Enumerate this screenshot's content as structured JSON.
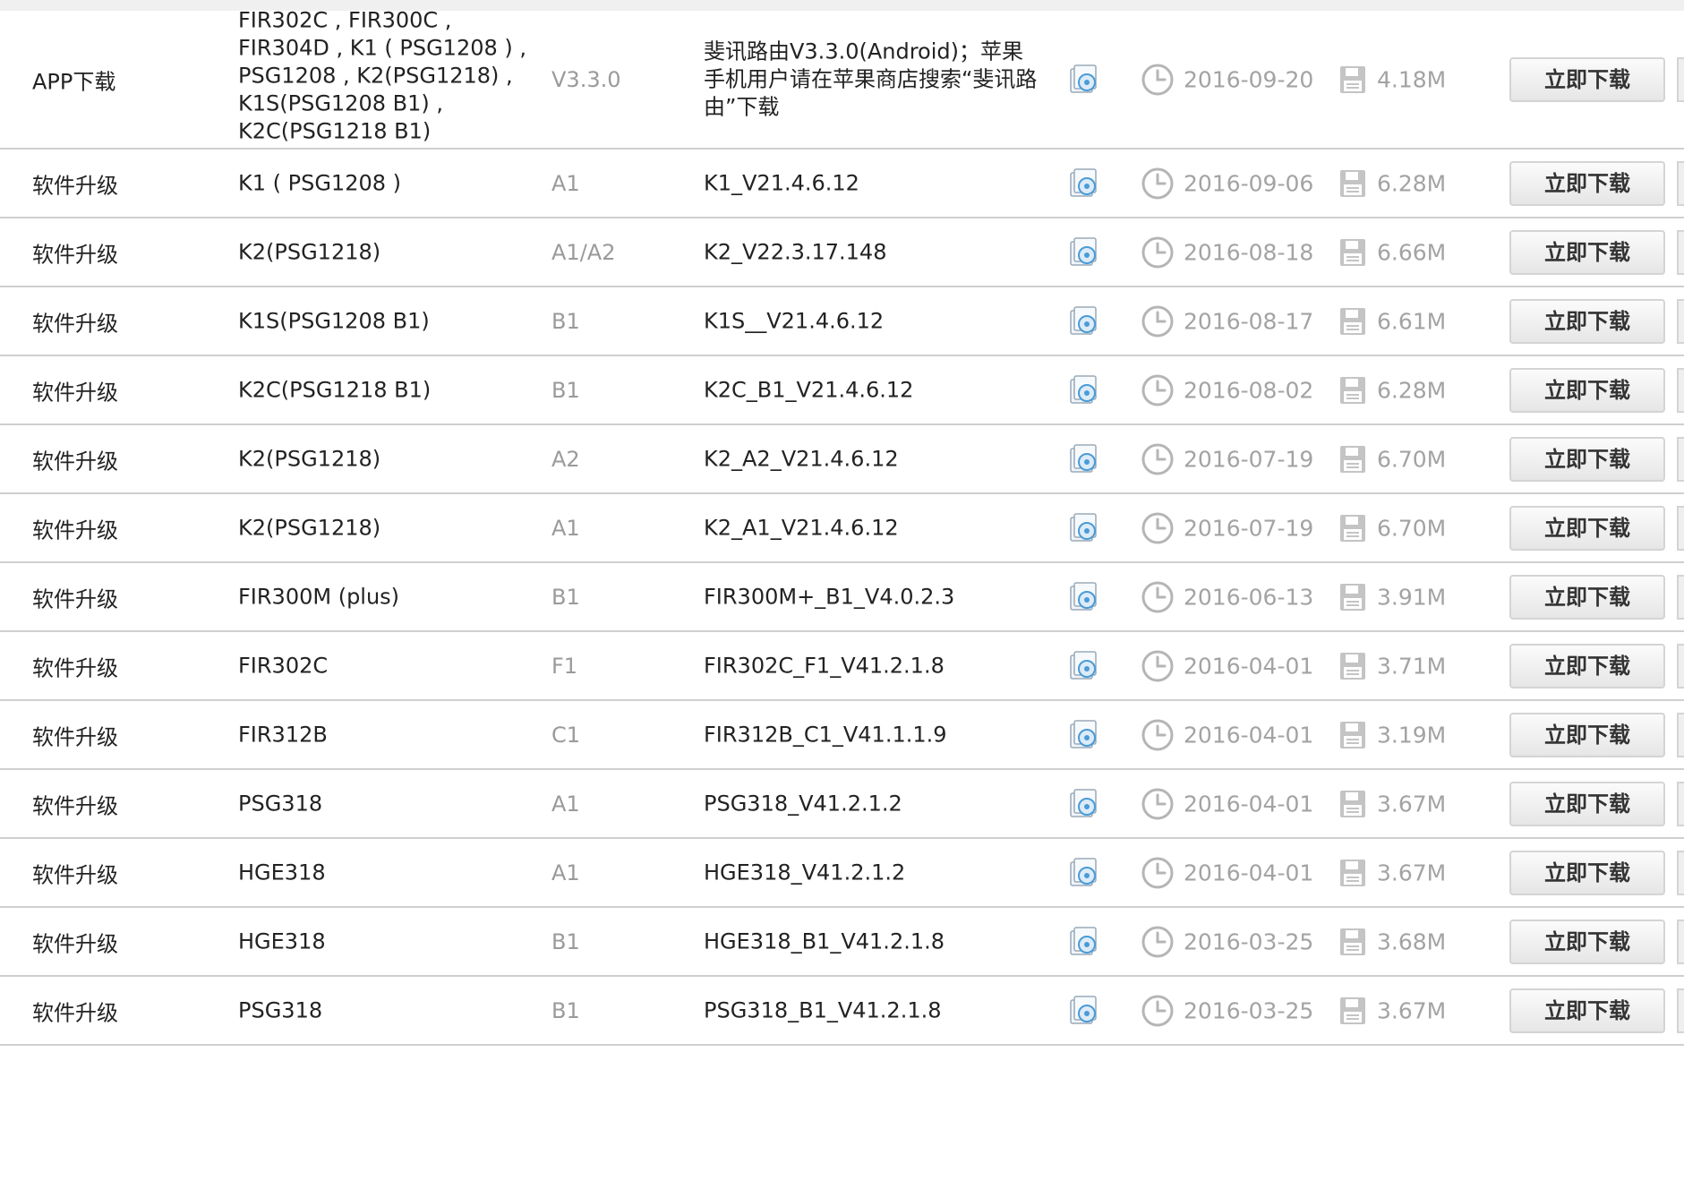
{
  "download_button_label": "立即下载",
  "rows": [
    {
      "type": "APP下载",
      "model": "FIR302C , FIR300C , FIR304D , K1 ( PSG1208 ) , PSG1208 , K2(PSG1218) , K1S(PSG1208 B1) , K2C(PSG1218 B1)",
      "hardware": "V3.3.0",
      "version": "斐讯路由V3.3.0(Android)；苹果手机用户请在苹果商店搜索“斐讯路由”下载",
      "date": "2016-09-20",
      "size": "4.18M"
    },
    {
      "type": "软件升级",
      "model": "K1 ( PSG1208 )",
      "hardware": "A1",
      "version": "K1_V21.4.6.12",
      "date": "2016-09-06",
      "size": "6.28M"
    },
    {
      "type": "软件升级",
      "model": "K2(PSG1218)",
      "hardware": "A1/A2",
      "version": "K2_V22.3.17.148",
      "date": "2016-08-18",
      "size": "6.66M"
    },
    {
      "type": "软件升级",
      "model": "K1S(PSG1208 B1)",
      "hardware": "B1",
      "version": "K1S__V21.4.6.12",
      "date": "2016-08-17",
      "size": "6.61M"
    },
    {
      "type": "软件升级",
      "model": "K2C(PSG1218 B1)",
      "hardware": "B1",
      "version": "K2C_B1_V21.4.6.12",
      "date": "2016-08-02",
      "size": "6.28M"
    },
    {
      "type": "软件升级",
      "model": "K2(PSG1218)",
      "hardware": "A2",
      "version": "K2_A2_V21.4.6.12",
      "date": "2016-07-19",
      "size": "6.70M"
    },
    {
      "type": "软件升级",
      "model": "K2(PSG1218)",
      "hardware": "A1",
      "version": "K2_A1_V21.4.6.12",
      "date": "2016-07-19",
      "size": "6.70M"
    },
    {
      "type": "软件升级",
      "model": "FIR300M (plus)",
      "hardware": "B1",
      "version": "FIR300M+_B1_V4.0.2.3",
      "date": "2016-06-13",
      "size": "3.91M"
    },
    {
      "type": "软件升级",
      "model": "FIR302C",
      "hardware": "F1",
      "version": "FIR302C_F1_V41.2.1.8",
      "date": "2016-04-01",
      "size": "3.71M"
    },
    {
      "type": "软件升级",
      "model": "FIR312B",
      "hardware": "C1",
      "version": "FIR312B_C1_V41.1.1.9",
      "date": "2016-04-01",
      "size": "3.19M"
    },
    {
      "type": "软件升级",
      "model": "PSG318",
      "hardware": "A1",
      "version": "PSG318_V41.2.1.2",
      "date": "2016-04-01",
      "size": "3.67M"
    },
    {
      "type": "软件升级",
      "model": "HGE318",
      "hardware": "A1",
      "version": "HGE318_V41.2.1.2",
      "date": "2016-04-01",
      "size": "3.67M"
    },
    {
      "type": "软件升级",
      "model": "HGE318",
      "hardware": "B1",
      "version": "HGE318_B1_V41.2.1.8",
      "date": "2016-03-25",
      "size": "3.68M"
    },
    {
      "type": "软件升级",
      "model": "PSG318",
      "hardware": "B1",
      "version": "PSG318_B1_V41.2.1.8",
      "date": "2016-03-25",
      "size": "3.67M"
    }
  ],
  "icons": {
    "install": "disk-install-icon",
    "date": "clock-icon",
    "size": "floppy-save-icon"
  },
  "colors": {
    "muted_text": "#a3a3a3",
    "divider": "#cfcfcf",
    "button_border": "#d4d4d4",
    "icon_blue": "#4a9bd6"
  }
}
